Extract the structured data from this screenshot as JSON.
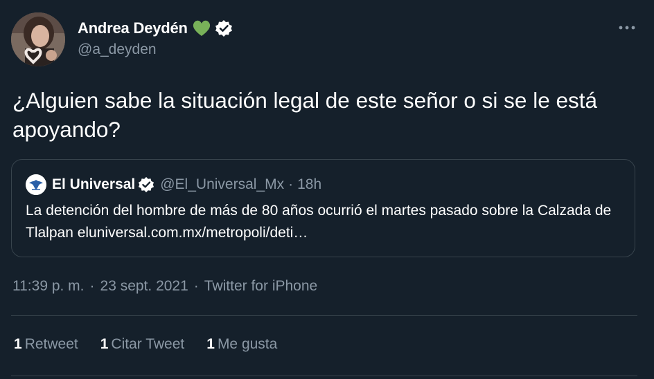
{
  "author": {
    "display_name": "Andrea Deydén",
    "handle": "@a_deyden",
    "heart_emoji_color": "#78b159",
    "verified_icon": "verified-badge-icon"
  },
  "tweet": {
    "text": "¿Alguien sabe la situación legal de este señor o si se le está apoyando?"
  },
  "quote": {
    "name": "El Universal",
    "handle": "@El_Universal_Mx",
    "separator": "·",
    "time": "18h",
    "text": "La detención del hombre de más de 80 años ocurrió el martes pasado sobre la Calzada de Tlalpan eluniversal.com.mx/metropoli/deti…"
  },
  "meta": {
    "time": "11:39 p. m.",
    "separator": "·",
    "date": "23 sept. 2021",
    "source": "Twitter for iPhone"
  },
  "stats": {
    "retweets_count": "1",
    "retweets_label": "Retweet",
    "quotes_count": "1",
    "quotes_label": "Citar Tweet",
    "likes_count": "1",
    "likes_label": "Me gusta"
  },
  "colors": {
    "background": "#15202b",
    "secondary_text": "#8b98a5",
    "border": "#38444d"
  }
}
